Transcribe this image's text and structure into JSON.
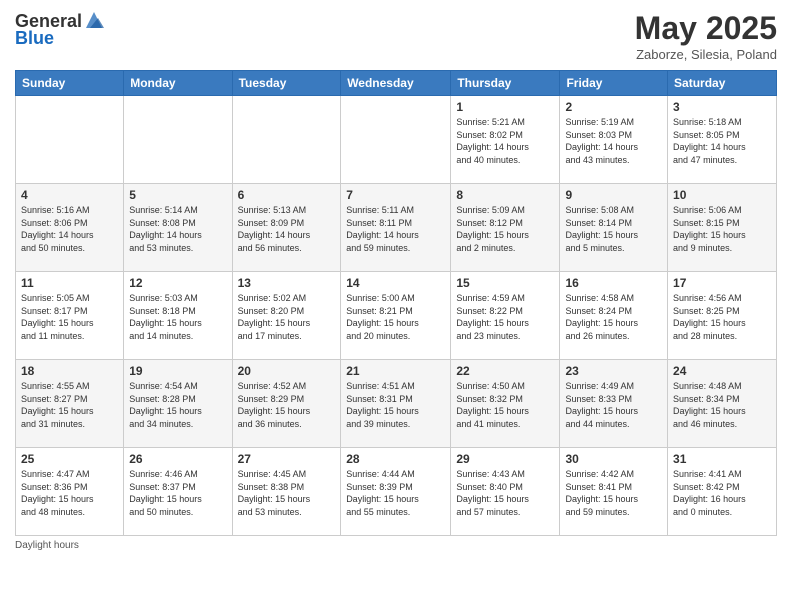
{
  "header": {
    "logo_line1": "General",
    "logo_line2": "Blue",
    "title": "May 2025",
    "location": "Zaborze, Silesia, Poland"
  },
  "days_of_week": [
    "Sunday",
    "Monday",
    "Tuesday",
    "Wednesday",
    "Thursday",
    "Friday",
    "Saturday"
  ],
  "weeks": [
    [
      {
        "day": "",
        "info": ""
      },
      {
        "day": "",
        "info": ""
      },
      {
        "day": "",
        "info": ""
      },
      {
        "day": "",
        "info": ""
      },
      {
        "day": "1",
        "info": "Sunrise: 5:21 AM\nSunset: 8:02 PM\nDaylight: 14 hours\nand 40 minutes."
      },
      {
        "day": "2",
        "info": "Sunrise: 5:19 AM\nSunset: 8:03 PM\nDaylight: 14 hours\nand 43 minutes."
      },
      {
        "day": "3",
        "info": "Sunrise: 5:18 AM\nSunset: 8:05 PM\nDaylight: 14 hours\nand 47 minutes."
      }
    ],
    [
      {
        "day": "4",
        "info": "Sunrise: 5:16 AM\nSunset: 8:06 PM\nDaylight: 14 hours\nand 50 minutes."
      },
      {
        "day": "5",
        "info": "Sunrise: 5:14 AM\nSunset: 8:08 PM\nDaylight: 14 hours\nand 53 minutes."
      },
      {
        "day": "6",
        "info": "Sunrise: 5:13 AM\nSunset: 8:09 PM\nDaylight: 14 hours\nand 56 minutes."
      },
      {
        "day": "7",
        "info": "Sunrise: 5:11 AM\nSunset: 8:11 PM\nDaylight: 14 hours\nand 59 minutes."
      },
      {
        "day": "8",
        "info": "Sunrise: 5:09 AM\nSunset: 8:12 PM\nDaylight: 15 hours\nand 2 minutes."
      },
      {
        "day": "9",
        "info": "Sunrise: 5:08 AM\nSunset: 8:14 PM\nDaylight: 15 hours\nand 5 minutes."
      },
      {
        "day": "10",
        "info": "Sunrise: 5:06 AM\nSunset: 8:15 PM\nDaylight: 15 hours\nand 9 minutes."
      }
    ],
    [
      {
        "day": "11",
        "info": "Sunrise: 5:05 AM\nSunset: 8:17 PM\nDaylight: 15 hours\nand 11 minutes."
      },
      {
        "day": "12",
        "info": "Sunrise: 5:03 AM\nSunset: 8:18 PM\nDaylight: 15 hours\nand 14 minutes."
      },
      {
        "day": "13",
        "info": "Sunrise: 5:02 AM\nSunset: 8:20 PM\nDaylight: 15 hours\nand 17 minutes."
      },
      {
        "day": "14",
        "info": "Sunrise: 5:00 AM\nSunset: 8:21 PM\nDaylight: 15 hours\nand 20 minutes."
      },
      {
        "day": "15",
        "info": "Sunrise: 4:59 AM\nSunset: 8:22 PM\nDaylight: 15 hours\nand 23 minutes."
      },
      {
        "day": "16",
        "info": "Sunrise: 4:58 AM\nSunset: 8:24 PM\nDaylight: 15 hours\nand 26 minutes."
      },
      {
        "day": "17",
        "info": "Sunrise: 4:56 AM\nSunset: 8:25 PM\nDaylight: 15 hours\nand 28 minutes."
      }
    ],
    [
      {
        "day": "18",
        "info": "Sunrise: 4:55 AM\nSunset: 8:27 PM\nDaylight: 15 hours\nand 31 minutes."
      },
      {
        "day": "19",
        "info": "Sunrise: 4:54 AM\nSunset: 8:28 PM\nDaylight: 15 hours\nand 34 minutes."
      },
      {
        "day": "20",
        "info": "Sunrise: 4:52 AM\nSunset: 8:29 PM\nDaylight: 15 hours\nand 36 minutes."
      },
      {
        "day": "21",
        "info": "Sunrise: 4:51 AM\nSunset: 8:31 PM\nDaylight: 15 hours\nand 39 minutes."
      },
      {
        "day": "22",
        "info": "Sunrise: 4:50 AM\nSunset: 8:32 PM\nDaylight: 15 hours\nand 41 minutes."
      },
      {
        "day": "23",
        "info": "Sunrise: 4:49 AM\nSunset: 8:33 PM\nDaylight: 15 hours\nand 44 minutes."
      },
      {
        "day": "24",
        "info": "Sunrise: 4:48 AM\nSunset: 8:34 PM\nDaylight: 15 hours\nand 46 minutes."
      }
    ],
    [
      {
        "day": "25",
        "info": "Sunrise: 4:47 AM\nSunset: 8:36 PM\nDaylight: 15 hours\nand 48 minutes."
      },
      {
        "day": "26",
        "info": "Sunrise: 4:46 AM\nSunset: 8:37 PM\nDaylight: 15 hours\nand 50 minutes."
      },
      {
        "day": "27",
        "info": "Sunrise: 4:45 AM\nSunset: 8:38 PM\nDaylight: 15 hours\nand 53 minutes."
      },
      {
        "day": "28",
        "info": "Sunrise: 4:44 AM\nSunset: 8:39 PM\nDaylight: 15 hours\nand 55 minutes."
      },
      {
        "day": "29",
        "info": "Sunrise: 4:43 AM\nSunset: 8:40 PM\nDaylight: 15 hours\nand 57 minutes."
      },
      {
        "day": "30",
        "info": "Sunrise: 4:42 AM\nSunset: 8:41 PM\nDaylight: 15 hours\nand 59 minutes."
      },
      {
        "day": "31",
        "info": "Sunrise: 4:41 AM\nSunset: 8:42 PM\nDaylight: 16 hours\nand 0 minutes."
      }
    ]
  ],
  "footer": {
    "note": "Daylight hours"
  }
}
